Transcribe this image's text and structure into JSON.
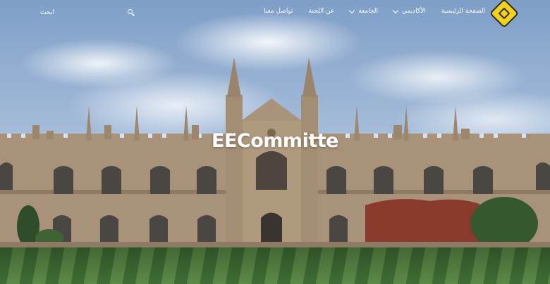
{
  "nav": {
    "logo_icon": "logo-icon",
    "items": [
      {
        "label": "الصفحة الرئيسية",
        "dropdown": false
      },
      {
        "label": "الأكاديمي",
        "dropdown": true
      },
      {
        "label": "الجامعة",
        "dropdown": true
      },
      {
        "label": "عن اللجنة",
        "dropdown": false
      },
      {
        "label": "تواصل معنا",
        "dropdown": false
      }
    ],
    "search_icon": "search-icon",
    "search_label": "ابحث"
  },
  "hero": {
    "title": "EECommitte",
    "background": "university-building-photo"
  },
  "colors": {
    "logo": "#f4d21a",
    "text": "#ffffff",
    "lawn_dark": "#3f6d34",
    "lawn_light": "#5b8a47",
    "stone": "#a8937a"
  }
}
